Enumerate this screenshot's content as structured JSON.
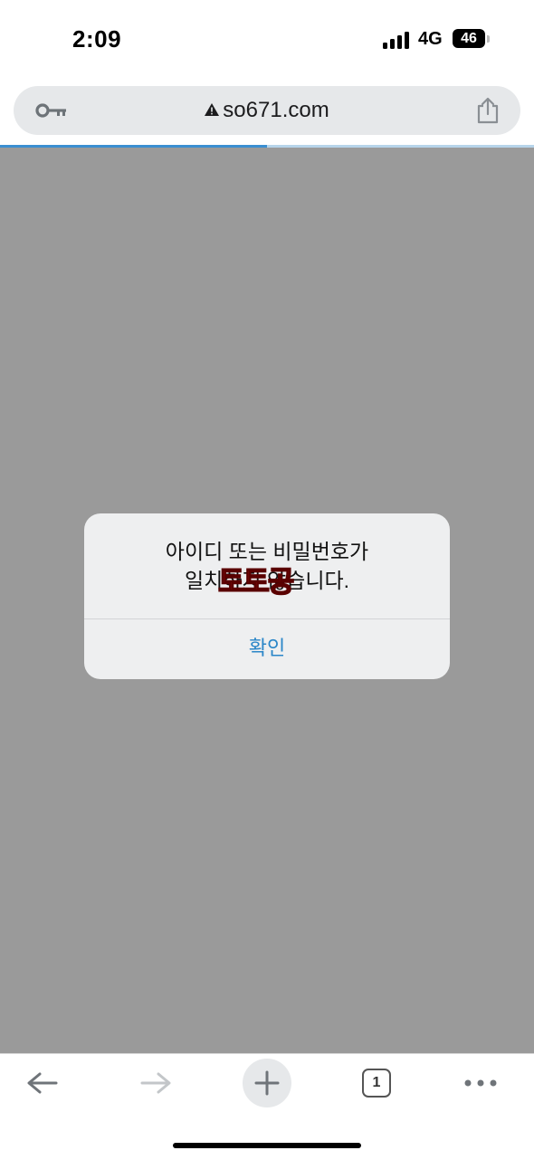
{
  "status_bar": {
    "time": "2:09",
    "network": "4G",
    "battery": "46"
  },
  "url_bar": {
    "url": "so671.com",
    "security": "warning-icon",
    "left_icon": "key-icon",
    "right_icon": "share-icon"
  },
  "progress": {
    "fraction": 0.5,
    "color": "#3b8fd1"
  },
  "dialog": {
    "message_line1": "아이디 또는 비밀번호가",
    "message_line2": "일치하지 않습니다.",
    "watermark": "토토공",
    "confirm_label": "확인",
    "confirm_color": "#2a86c8"
  },
  "toolbar": {
    "back_icon": "back-arrow-icon",
    "forward_icon": "forward-arrow-icon",
    "new_tab_icon": "plus-icon",
    "tab_count": "1",
    "menu_icon": "more-dots-icon"
  },
  "colors": {
    "overlay": "#9a9a9a",
    "url_bar_bg": "#e6e8ea"
  }
}
